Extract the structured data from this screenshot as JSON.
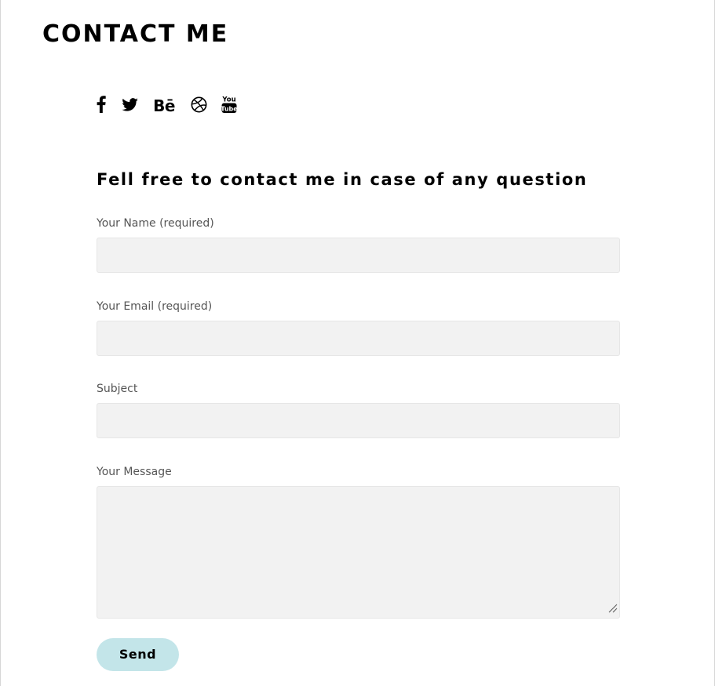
{
  "page": {
    "title": "CONTACT ME"
  },
  "social": {
    "icons": [
      "facebook-icon",
      "twitter-icon",
      "behance-icon",
      "dribbble-icon",
      "youtube-icon"
    ],
    "behance_label": "Bē",
    "youtube_top": "You",
    "youtube_bottom": "Tube"
  },
  "contact": {
    "intro": "Fell free to contact me in case of any question",
    "fields": [
      {
        "label": "Your Name (required)",
        "value": "",
        "placeholder": ""
      },
      {
        "label": "Your Email (required)",
        "value": "",
        "placeholder": ""
      },
      {
        "label": "Subject",
        "value": "",
        "placeholder": ""
      },
      {
        "label": "Your Message",
        "value": "",
        "placeholder": ""
      }
    ],
    "send_label": "Send"
  },
  "colors": {
    "text": "#000000",
    "label": "#555555",
    "input_bg": "#f2f2f2",
    "button_bg": "#c3e5e9"
  }
}
